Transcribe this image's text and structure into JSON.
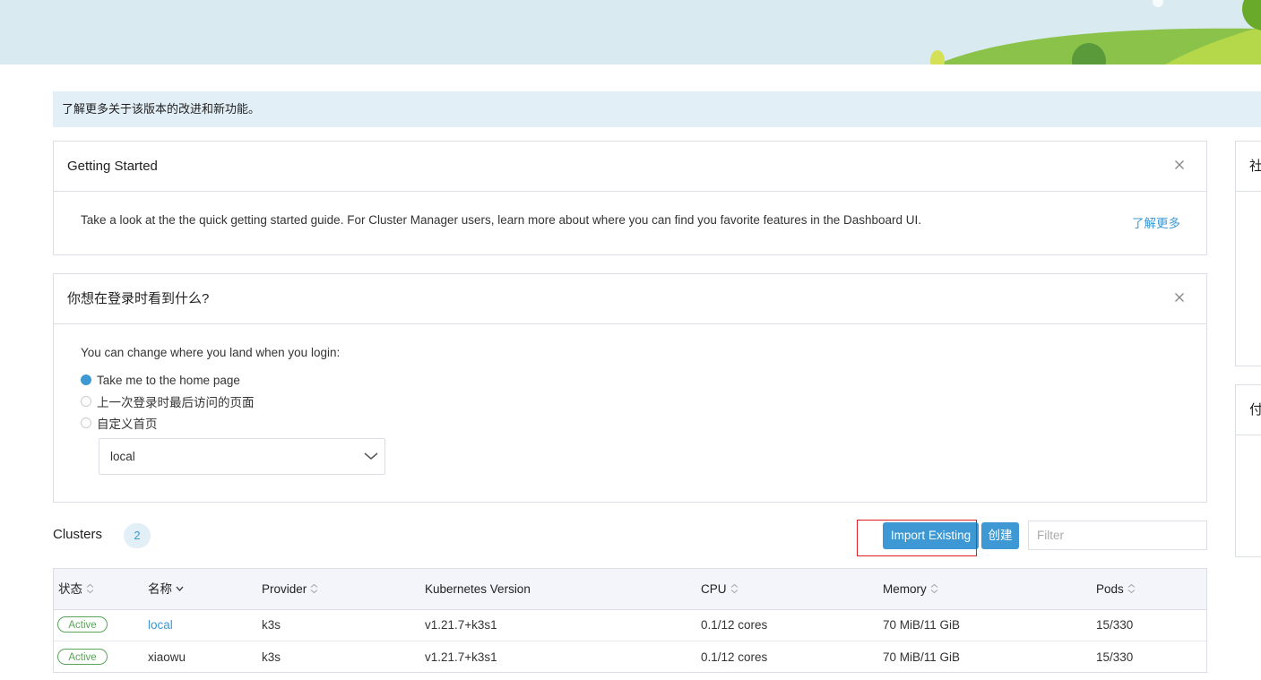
{
  "colors": {
    "accent": "#3d98d3",
    "banner_bg": "#d9eaf0",
    "active_green": "#5aa45a",
    "highlight_red": "#e02020"
  },
  "info_bar": {
    "text": "了解更多关于该版本的改进和新功能。"
  },
  "getting_started": {
    "title": "Getting Started",
    "text": "Take a look at the the quick getting started guide. For Cluster Manager users, learn more about where you can find you favorite features in the Dashboard UI.",
    "link": "了解更多",
    "close_icon": "close-icon"
  },
  "landing_pref": {
    "title": "你想在登录时看到什么?",
    "prompt": "You can change where you land when you login:",
    "options": [
      {
        "label": "Take me to the home page",
        "checked": true
      },
      {
        "label": "上一次登录时最后访问的页面",
        "checked": false
      },
      {
        "label": "自定义首页",
        "checked": false
      }
    ],
    "select_value": "local"
  },
  "clusters": {
    "title": "Clusters",
    "count": "2",
    "import_label": "Import Existing",
    "create_label": "创建",
    "filter_placeholder": "Filter",
    "columns": [
      "状态",
      "名称",
      "Provider",
      "Kubernetes Version",
      "CPU",
      "Memory",
      "Pods"
    ],
    "rows": [
      {
        "state": "Active",
        "name": "local",
        "provider": "k3s",
        "version": "v1.21.7+k3s1",
        "cpu": "0.1/12 cores",
        "memory": "70 MiB/11 GiB",
        "pods": "15/330"
      },
      {
        "state": "Active",
        "name": "xiaowu",
        "provider": "k3s",
        "version": "v1.21.7+k3s1",
        "cpu": "0.1/12 cores",
        "memory": "70 MiB/11 GiB",
        "pods": "15/330"
      }
    ]
  },
  "side_panels": [
    {
      "title": "社"
    },
    {
      "title": "付"
    }
  ]
}
